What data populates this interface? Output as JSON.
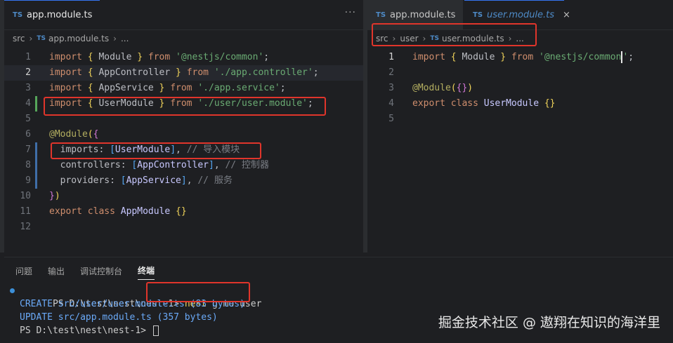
{
  "left_editor": {
    "tab": {
      "badge": "TS",
      "label": "app.module.ts"
    },
    "more_icon": "···",
    "breadcrumb": [
      "src",
      "app.module.ts",
      "..."
    ],
    "breadcrumb_badge": "TS",
    "lines": [
      {
        "n": "1",
        "tokens": [
          [
            "kw",
            "import "
          ],
          [
            "br",
            "{ "
          ],
          [
            "id",
            "Module "
          ],
          [
            "br",
            "} "
          ],
          [
            "kw",
            "from "
          ],
          [
            "str",
            "'@nestjs/common'"
          ],
          [
            "id",
            ";"
          ]
        ]
      },
      {
        "n": "2",
        "tokens": [
          [
            "kw",
            "import "
          ],
          [
            "br",
            "{ "
          ],
          [
            "id",
            "AppController "
          ],
          [
            "br",
            "} "
          ],
          [
            "kw",
            "from "
          ],
          [
            "str",
            "'./app.controller'"
          ],
          [
            "id",
            ";"
          ]
        ]
      },
      {
        "n": "3",
        "tokens": [
          [
            "kw",
            "import "
          ],
          [
            "br",
            "{ "
          ],
          [
            "id",
            "AppService "
          ],
          [
            "br",
            "} "
          ],
          [
            "kw",
            "from "
          ],
          [
            "str",
            "'./app.service'"
          ],
          [
            "id",
            ";"
          ]
        ]
      },
      {
        "n": "4",
        "tokens": [
          [
            "kw",
            "import "
          ],
          [
            "br",
            "{ "
          ],
          [
            "id",
            "UserModule "
          ],
          [
            "br",
            "} "
          ],
          [
            "kw",
            "from "
          ],
          [
            "str",
            "'./user/user.module'"
          ],
          [
            "id",
            ";"
          ]
        ]
      },
      {
        "n": "5",
        "tokens": []
      },
      {
        "n": "6",
        "tokens": [
          [
            "dec",
            "@Module"
          ],
          [
            "br",
            "("
          ],
          [
            "br2",
            "{"
          ]
        ]
      },
      {
        "n": "7",
        "tokens": [
          [
            "id",
            "  imports: "
          ],
          [
            "br3",
            "["
          ],
          [
            "cls",
            "UserModule"
          ],
          [
            "br3",
            "]"
          ],
          [
            "id",
            ", "
          ],
          [
            "cm",
            "// 导入模块"
          ]
        ]
      },
      {
        "n": "8",
        "tokens": [
          [
            "id",
            "  controllers: "
          ],
          [
            "br3",
            "["
          ],
          [
            "cls",
            "AppController"
          ],
          [
            "br3",
            "]"
          ],
          [
            "id",
            ", "
          ],
          [
            "cm",
            "// 控制器"
          ]
        ]
      },
      {
        "n": "9",
        "tokens": [
          [
            "id",
            "  providers: "
          ],
          [
            "br3",
            "["
          ],
          [
            "cls",
            "AppService"
          ],
          [
            "br3",
            "]"
          ],
          [
            "id",
            ", "
          ],
          [
            "cm",
            "// 服务"
          ]
        ]
      },
      {
        "n": "10",
        "tokens": [
          [
            "br2",
            "}"
          ],
          [
            "br",
            ")"
          ]
        ]
      },
      {
        "n": "11",
        "tokens": [
          [
            "kw",
            "export "
          ],
          [
            "kw",
            "class "
          ],
          [
            "cls",
            "AppModule "
          ],
          [
            "br",
            "{}"
          ]
        ]
      },
      {
        "n": "12",
        "tokens": []
      }
    ]
  },
  "right_editor": {
    "tabs": [
      {
        "badge": "TS",
        "label": "app.module.ts",
        "active": false
      },
      {
        "badge": "TS",
        "label": "user.module.ts",
        "active": true,
        "close": "×"
      }
    ],
    "breadcrumb": [
      "src",
      "user",
      "user.module.ts",
      "..."
    ],
    "breadcrumb_badge": "TS",
    "lines": [
      {
        "n": "1",
        "tokens": [
          [
            "kw",
            "import "
          ],
          [
            "br",
            "{ "
          ],
          [
            "id",
            "Module "
          ],
          [
            "br",
            "} "
          ],
          [
            "kw",
            "from "
          ],
          [
            "str",
            "'@nestjs/common"
          ],
          [
            "cursor",
            ""
          ],
          [
            "str",
            "'"
          ],
          [
            "id",
            ";"
          ]
        ]
      },
      {
        "n": "2",
        "tokens": []
      },
      {
        "n": "3",
        "tokens": [
          [
            "dec",
            "@Module"
          ],
          [
            "br",
            "("
          ],
          [
            "br2",
            "{}"
          ],
          [
            "br",
            ")"
          ]
        ]
      },
      {
        "n": "4",
        "tokens": [
          [
            "kw",
            "export "
          ],
          [
            "kw",
            "class "
          ],
          [
            "cls",
            "UserModule "
          ],
          [
            "br",
            "{}"
          ]
        ]
      },
      {
        "n": "5",
        "tokens": []
      }
    ]
  },
  "panel": {
    "tabs": [
      "问题",
      "输出",
      "调试控制台",
      "终端"
    ],
    "active_tab": "终端"
  },
  "terminal": {
    "lines": [
      {
        "prompt": "PS D:\\test\\nest\\nest-1> ",
        "cmd_kw": "nest",
        "cmd_rest": " g mo user"
      },
      {
        "text": "CREATE src/user/user.module.ts (83 bytes)"
      },
      {
        "text": "UPDATE src/app.module.ts (357 bytes)"
      },
      {
        "prompt": "PS D:\\test\\nest\\nest-1> "
      }
    ]
  },
  "watermark": "掘金技术社区 @ 遨翔在知识的海洋里",
  "colors": {
    "highlight_box": "#e0352b",
    "accent": "#3574f0"
  }
}
